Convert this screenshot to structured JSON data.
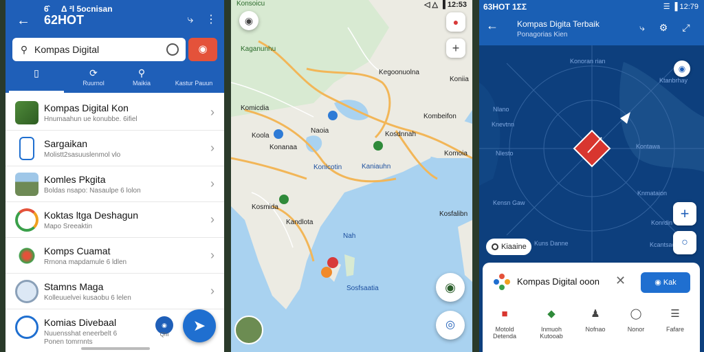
{
  "left": {
    "status": "6̂   Δ ²l 5ocnisan",
    "title": "62HOT",
    "search": {
      "value": "Kompas Digital"
    },
    "tabs": [
      {
        "label": "",
        "icon": "phone-icon"
      },
      {
        "label": "Ruurnol",
        "icon": "recent-icon"
      },
      {
        "label": "Maikia",
        "icon": "search-icon"
      },
      {
        "label": "Kastur Pauun",
        "icon": "category-icon"
      }
    ],
    "items": [
      {
        "title": "Kompas Digital Kon",
        "sub": "Hnumaahun ue konubbe. 6ifiel"
      },
      {
        "title": "Sargaikan",
        "sub": "Molistt2sasuuslenmol vlo"
      },
      {
        "title": "Komles Pkgita",
        "sub": "Boldas nsapo: Nasaulpe 6 lolon"
      },
      {
        "title": "Koktas ltga Deshagun",
        "sub": "Mapo Sreeaktin"
      },
      {
        "title": "Komps Cuamat",
        "sub": "Rrnona mapdamule 6 ldlen"
      },
      {
        "title": "Stamns Maga",
        "sub": "Kolleuuelvei kusaobu 6 lelen"
      },
      {
        "title": "Komias Divebaal",
        "sub": "Nuuensshat eneerbelt 6"
      },
      {
        "title": "",
        "sub": "Ponen tomrnnts"
      }
    ],
    "badge_label": "Qhi"
  },
  "mid": {
    "status": "◁ △ ▐ 12:53",
    "labels": [
      "Konsoicu",
      "Kaganunhu",
      "Kegoonuolna",
      "Koniia",
      "Komicdia",
      "Kombeifon",
      "Naoia",
      "Koola",
      "Kosdnnah",
      "Konanaa",
      "Konicotin",
      "Kaniauhn",
      "Komoia",
      "Kosmida",
      "Kosfalibn",
      "Kandlota",
      "Nah",
      "Sosfsaatia"
    ]
  },
  "right": {
    "status_left": "63HOT 1ΣΣ",
    "status_right": "☰ ▐ 12:79",
    "title": "Kompas Digita Terbaik",
    "sub": "Ponagorias Kien",
    "labels": [
      "Konoran rian",
      "Nlano",
      "Knevtnn",
      "Ktanbrhay",
      "Kensn Gaw",
      "Kontawa",
      "Knmataion",
      "Konrdin",
      "Kcantsacen",
      "Kuns Danne",
      "Nlesto"
    ],
    "chip": "Kiaaine",
    "sheet": {
      "title": "Kompas Digital ooon",
      "go": "Kak",
      "actions": [
        "Motold Detenda",
        "Inmuoh Kutooab",
        "Nofnao",
        "Nonor",
        "Fafare"
      ]
    }
  }
}
